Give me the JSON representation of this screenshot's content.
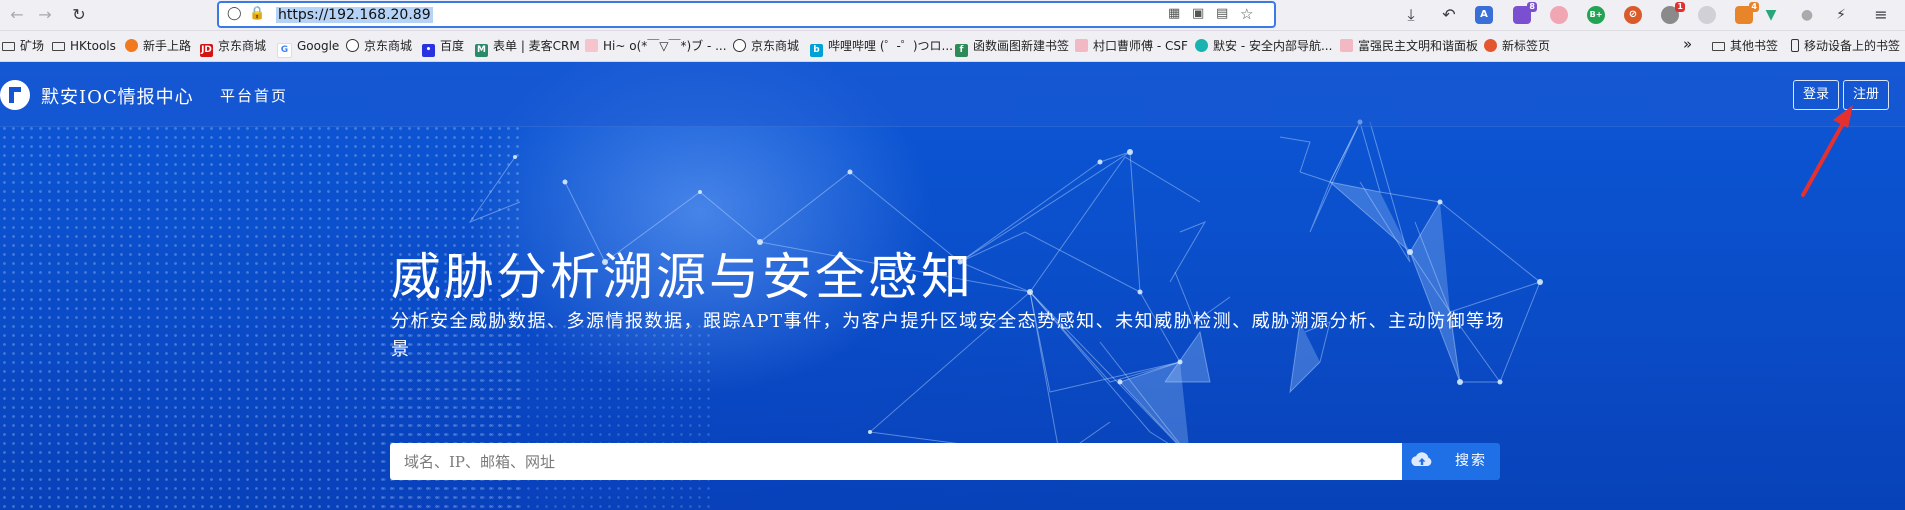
{
  "browser": {
    "url": "https://192.168.20.89",
    "bookmarks": [
      {
        "label": "矿场",
        "icon": "folder-icon"
      },
      {
        "label": "HKtools",
        "icon": "folder-icon"
      },
      {
        "label": "新手上路",
        "icon": "firefox-icon"
      },
      {
        "label": "京东商城",
        "icon": "jd-icon"
      },
      {
        "label": "Google",
        "icon": "google-icon"
      },
      {
        "label": "京东商城",
        "icon": "globe-icon"
      },
      {
        "label": "百度",
        "icon": "baidu-icon"
      },
      {
        "label": "表单 | 麦客CRM",
        "icon": "mikecrm-icon"
      },
      {
        "label": "Hi~ o(*￣▽￣*)ブ - ...",
        "icon": "site-icon"
      },
      {
        "label": "京东商城",
        "icon": "globe-icon"
      },
      {
        "label": "哔哩哔哩 (゜-゜)つロ...",
        "icon": "bilibili-icon"
      },
      {
        "label": "函数画图新建书签",
        "icon": "graph-icon"
      },
      {
        "label": "村口曹师傅 - CSF",
        "icon": "site-icon"
      },
      {
        "label": "默安 - 安全内部导航...",
        "icon": "moresec-icon"
      },
      {
        "label": "富强民主文明和谐面板",
        "icon": "site-icon"
      },
      {
        "label": "新标签页",
        "icon": "firefox-icon"
      }
    ],
    "bookmarks_right": [
      {
        "label": "其他书签",
        "icon": "folder-icon"
      },
      {
        "label": "移动设备上的书签",
        "icon": "mobile-icon"
      }
    ],
    "extension_badges": {
      "first": "8",
      "second": "1",
      "third": "4"
    },
    "ext_labels": {
      "b_plus": "B+"
    }
  },
  "site": {
    "brand": "默安IOC情报中心",
    "nav_home": "平台首页",
    "login_label": "登录",
    "register_label": "注册"
  },
  "hero": {
    "title": "威胁分析溯源与安全感知",
    "subtitle": "分析安全威胁数据、多源情报数据，跟踪APT事件，为客户提升区域安全态势感知、未知威胁检测、威胁溯源分析、主动防御等场景",
    "search_placeholder": "域名、IP、邮箱、网址",
    "search_value": "",
    "search_button": "搜索"
  },
  "colors": {
    "accent": "#1f6fe6",
    "page_bg": "#0b4fc7",
    "annotation_arrow": "#e53030"
  }
}
